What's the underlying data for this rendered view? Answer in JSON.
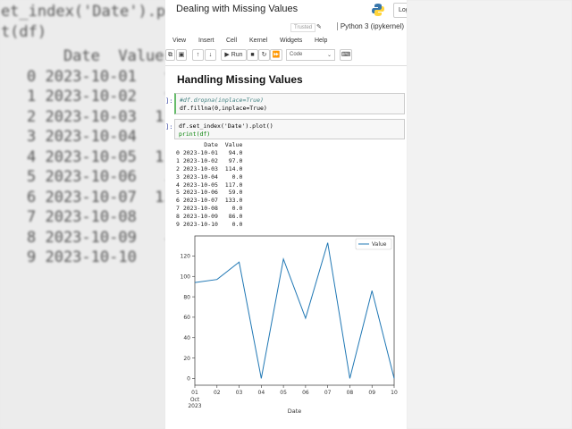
{
  "notebook": {
    "title": "Dealing with Missing Values",
    "logout": "Log",
    "trusted": "Trusted",
    "kernel": "Python 3 (ipykernel)",
    "menu": [
      "View",
      "Insert",
      "Cell",
      "Kernel",
      "Widgets",
      "Help"
    ],
    "toolbar": {
      "run": "Run",
      "cell_type": "Code"
    },
    "heading": "Handling Missing Values",
    "cells": [
      {
        "prompt": "]:",
        "lines": [
          "#df.dropna(inplace=True)",
          "df.fillna(0,inplace=True)"
        ]
      },
      {
        "prompt": "]:",
        "lines": [
          "df.set_index('Date').plot()",
          "print(df)"
        ]
      }
    ],
    "output_header": "        Date  Value",
    "output_rows": [
      "0 2023-10-01   94.0",
      "1 2023-10-02   97.0",
      "2 2023-10-03  114.0",
      "3 2023-10-04    0.0",
      "4 2023-10-05  117.0",
      "5 2023-10-06   59.0",
      "6 2023-10-07  133.0",
      "7 2023-10-08    0.0",
      "8 2023-10-09   86.0",
      "9 2023-10-10    0.0"
    ]
  },
  "chart_data": {
    "type": "line",
    "x": [
      "01",
      "02",
      "03",
      "04",
      "05",
      "06",
      "07",
      "08",
      "09",
      "10"
    ],
    "x_sublabel": [
      "Oct",
      "2023"
    ],
    "series": [
      {
        "name": "Value",
        "values": [
          94,
          97,
          114,
          0,
          117,
          59,
          133,
          0,
          86,
          0
        ],
        "color": "#1f77b4"
      }
    ],
    "xlabel": "Date",
    "ylabel": "",
    "ylim": [
      -6.65,
      139.65
    ],
    "yticks": [
      0,
      20,
      40,
      60,
      80,
      100,
      120
    ],
    "legend": "top-right",
    "grid": false
  }
}
